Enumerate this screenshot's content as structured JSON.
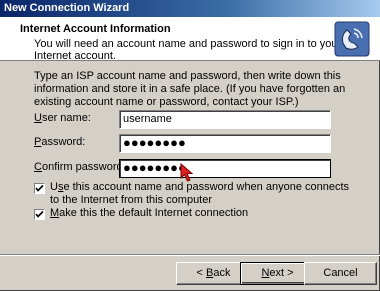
{
  "window": {
    "title": "New Connection Wizard"
  },
  "header": {
    "title": "Internet Account Information",
    "subtitle": "You will need an account name and password to sign in to your Internet account.",
    "icon": "phone-icon"
  },
  "intro": "Type an ISP account name and password, then write down this information and store it in a safe place. (If you have forgotten an existing account name or password, contact your ISP.)",
  "form": {
    "username_label_hotkey": "U",
    "username_label_rest": "ser name:",
    "username_value": "username",
    "password_label_hotkey": "P",
    "password_label_rest": "assword:",
    "password_value": "●●●●●●●●",
    "confirm_label_hotkey": "C",
    "confirm_label_rest": "onfirm password:",
    "confirm_value": "●●●●●●●●"
  },
  "options": {
    "use_for_all_prefix": "U",
    "use_for_all_hotkey": "s",
    "use_for_all_rest": "e this account  name and password when anyone connects to the Internet from this computer",
    "use_for_all_checked": true,
    "default_conn_prefix": "",
    "default_conn_hotkey": "M",
    "default_conn_rest": "ake this the default Internet connection",
    "default_conn_checked": true
  },
  "buttons": {
    "back_prefix": "< ",
    "back_hotkey": "B",
    "back_rest": "ack",
    "next_hotkey": "N",
    "next_rest": "ext >",
    "cancel": "Cancel"
  }
}
